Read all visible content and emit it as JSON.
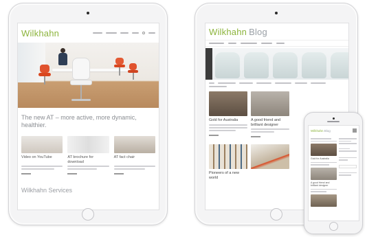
{
  "tablet_left": {
    "brand": "Wilkhahn",
    "headline": "The new AT – more active, more dynamic, healthier.",
    "cards": [
      {
        "title": "Video on YouTube",
        "thumb_color": "#d8d4cf"
      },
      {
        "title": "AT brochure for download",
        "thumb_color": "#e6e6e6"
      },
      {
        "title": "AT fact chair",
        "thumb_color": "#d2ccc6"
      }
    ],
    "footer_heading": "Wilkhahn Services"
  },
  "tablet_right": {
    "brand": "Wilkhahn",
    "brand_suffix": "Blog",
    "posts": [
      {
        "title": "Gold for Australia",
        "image_color": "#7a6a5a"
      },
      {
        "title": "A good friend and brilliant designer",
        "image_color": "#a8a29a"
      },
      {
        "title": "Pioneers of a new world",
        "image_color": "#c9b9a2"
      }
    ]
  },
  "phone": {
    "brand": "Wilkhahn",
    "brand_suffix": "Blog",
    "posts": [
      {
        "title": "Gold for Australia"
      },
      {
        "title": "A good friend and brilliant designer"
      }
    ]
  },
  "colors": {
    "brand_green": "#8cb43c",
    "chair_orange": "#e0522d",
    "floor_wood": "#c19468"
  }
}
